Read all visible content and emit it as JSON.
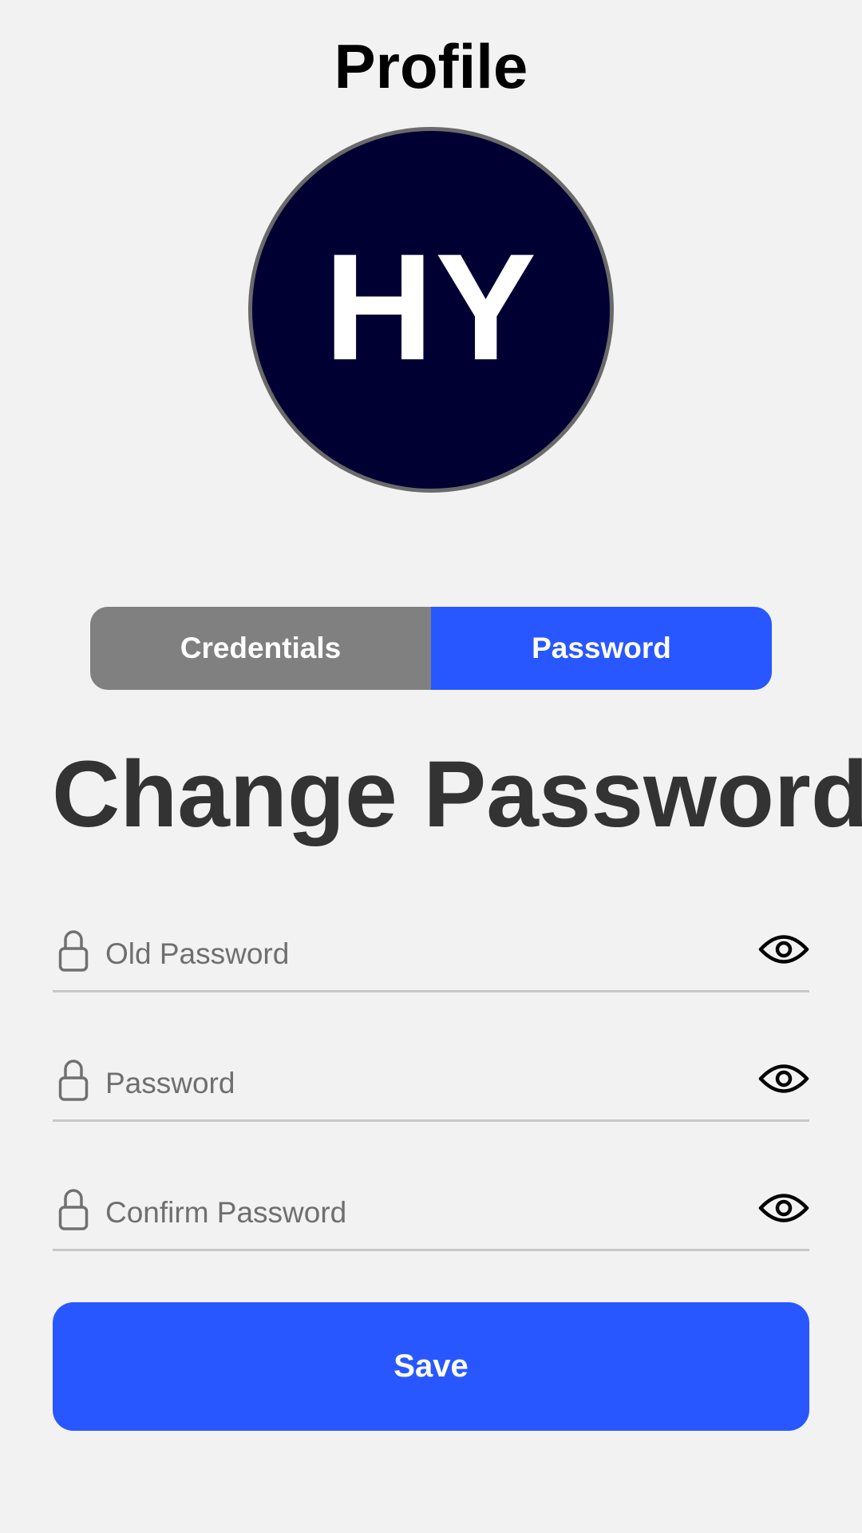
{
  "header": {
    "title": "Profile"
  },
  "avatar": {
    "initials": "HY",
    "background_color": "#000033"
  },
  "tabs": [
    {
      "label": "Credentials",
      "active": false,
      "color": "#808080"
    },
    {
      "label": "Password",
      "active": true,
      "color": "#2957ff"
    }
  ],
  "form": {
    "title": "Change Password",
    "fields": [
      {
        "placeholder": "Old Password",
        "value": "",
        "icon": "lock-icon",
        "toggle_icon": "eye-icon"
      },
      {
        "placeholder": "Password",
        "value": "",
        "icon": "lock-icon",
        "toggle_icon": "eye-icon"
      },
      {
        "placeholder": "Confirm Password",
        "value": "",
        "icon": "lock-icon",
        "toggle_icon": "eye-icon"
      }
    ],
    "save_label": "Save"
  },
  "colors": {
    "accent": "#2957ff",
    "background": "#f2f2f3",
    "heading": "#333333"
  }
}
